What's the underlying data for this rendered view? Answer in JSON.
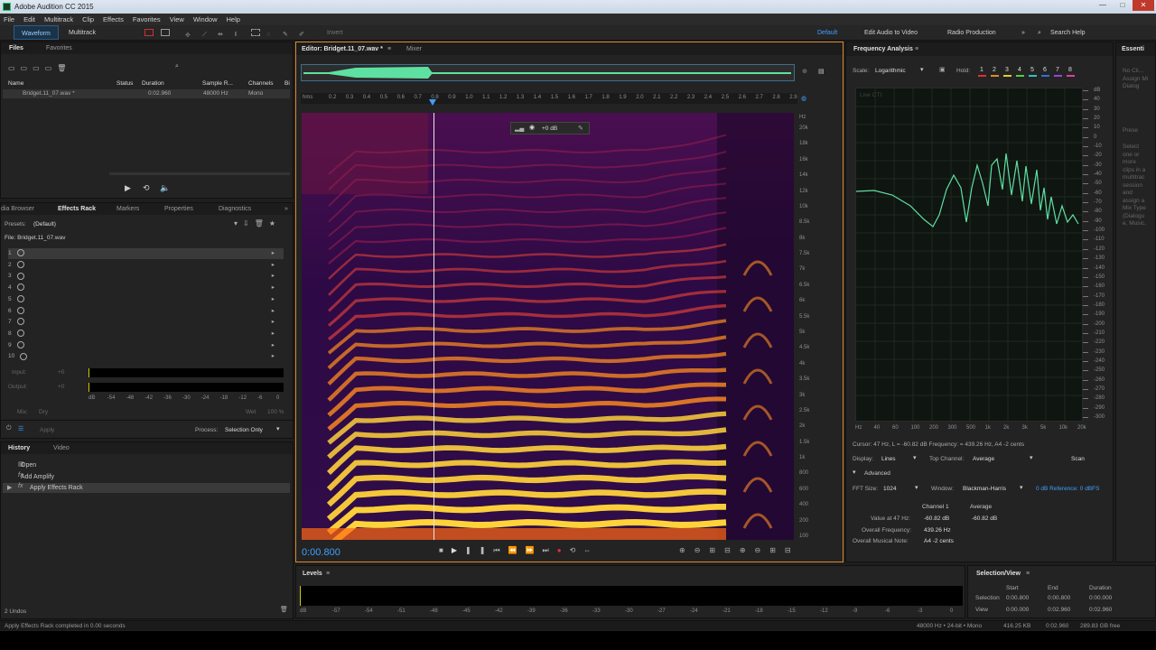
{
  "window": {
    "title": "Adobe Audition CC 2015"
  },
  "menu": [
    "File",
    "Edit",
    "Multitrack",
    "Clip",
    "Effects",
    "Favorites",
    "View",
    "Window",
    "Help"
  ],
  "toolbar": {
    "waveform": "Waveform",
    "multitrack": "Multitrack",
    "invert": "Invert",
    "workspace_default": "Default",
    "edit_video": "Edit Audio to Video",
    "radio": "Radio Production",
    "search": "Search Help"
  },
  "files": {
    "tabs": [
      "Files",
      "Favorites"
    ],
    "columns": [
      "Name",
      "Status",
      "Duration",
      "Sample R...",
      "Channels",
      "Bi"
    ],
    "rows": [
      {
        "name": "Bridget.11_07.wav *",
        "duration": "0:02.960",
        "rate": "48000 Hz",
        "channels": "Mono"
      }
    ]
  },
  "effects": {
    "tabs": [
      "dia Browser",
      "Effects Rack",
      "Markers",
      "Properties",
      "Diagnostics"
    ],
    "presets_label": "Presets:",
    "presets_value": "(Default)",
    "file_label": "File: Bridget.11_07.wav",
    "slots": [
      "1",
      "2",
      "3",
      "4",
      "5",
      "6",
      "7",
      "8",
      "9",
      "10"
    ],
    "input_label": "Input:",
    "input_val": "+0",
    "output_label": "Output:",
    "output_val": "+0",
    "meter_ticks": [
      "dB",
      "-54",
      "-48",
      "-42",
      "-36",
      "-30",
      "-24",
      "-18",
      "-12",
      "-6",
      "0"
    ],
    "mix_label": "Mix:",
    "dry": "Dry",
    "wet": "Wet",
    "wet_pct": "100 %",
    "apply": "Apply",
    "process_label": "Process:",
    "process_value": "Selection Only"
  },
  "history": {
    "tabs": [
      "History",
      "Video"
    ],
    "items": [
      "Open",
      "Add Amplify",
      "Apply Effects Rack"
    ],
    "undos": "2 Undos"
  },
  "editor": {
    "tabs": [
      "Editor: Bridget.11_07.wav *",
      "Mixer"
    ],
    "ruler_unit": "hms",
    "ruler": [
      "0.2",
      "0.3",
      "0.4",
      "0.5",
      "0.6",
      "0.7",
      "0.8",
      "0.9",
      "1.0",
      "1.1",
      "1.2",
      "1.3",
      "1.4",
      "1.5",
      "1.6",
      "1.7",
      "1.8",
      "1.9",
      "2.0",
      "2.1",
      "2.2",
      "2.3",
      "2.4",
      "2.5",
      "2.6",
      "2.7",
      "2.8",
      "2.9"
    ],
    "hz_label": "Hz",
    "hz_ticks": [
      "20k",
      "18k",
      "16k",
      "14k",
      "12k",
      "10k",
      "8.5k",
      "8k",
      "7.5k",
      "7k",
      "6.5k",
      "6k",
      "5.5k",
      "5k",
      "4.5k",
      "4k",
      "3.5k",
      "3k",
      "2.5k",
      "2k",
      "1.5k",
      "1k",
      "800",
      "600",
      "400",
      "200",
      "100"
    ],
    "hud": "+0 dB",
    "time": "0:00.800",
    "playhead_fraction": 0.27
  },
  "freq": {
    "title": "Frequency Analysis",
    "scale_label": "Scale:",
    "scale_value": "Logarithmic",
    "hold_label": "Hold:",
    "holds": [
      "1",
      "2",
      "3",
      "4",
      "5",
      "6",
      "7",
      "8"
    ],
    "hold_colors": [
      "#e03030",
      "#e08a20",
      "#e0d020",
      "#50d040",
      "#30c0c0",
      "#3070e0",
      "#a040e0",
      "#e040a0"
    ],
    "live_cti": "Live CTI",
    "db_ticks": [
      "dB",
      "40",
      "30",
      "20",
      "10",
      "0",
      "-10",
      "-20",
      "-30",
      "-40",
      "-50",
      "-60",
      "-70",
      "-80",
      "-90",
      "-100",
      "-110",
      "-120",
      "-130",
      "-140",
      "-150",
      "-160",
      "-170",
      "-180",
      "-190",
      "-200",
      "-210",
      "-220",
      "-230",
      "-240",
      "-250",
      "-260",
      "-270",
      "-280",
      "-290",
      "-300"
    ],
    "x_ticks": [
      "Hz",
      "40",
      "60",
      "100",
      "200",
      "300",
      "500",
      "1k",
      "2k",
      "3k",
      "5k",
      "10k",
      "20k"
    ],
    "cursor_text": "Cursor: 47 Hz, L = -60.82 dB  Frequency: = 439.26 Hz, A4 -2 cents",
    "display_label": "Display:",
    "display_value": "Lines",
    "topch_label": "Top Channel:",
    "topch_value": "Average",
    "scan": "Scan",
    "advanced": "Advanced",
    "fft_label": "FFT Size:",
    "fft_value": "1024",
    "window_label": "Window:",
    "window_value": "Blackman-Harris",
    "ref_text": "0 dB Reference: 0 dBFS",
    "col1": "Channel 1",
    "col2": "Average",
    "value_label": "Value at 47 Hz:",
    "value1": "-60.82 dB",
    "value2": "-60.82 dB",
    "overall_label": "Overall Frequency:",
    "overall1": "439.26 Hz",
    "note_label": "Overall Musical Note:",
    "note1": "A4 -2 cents"
  },
  "essential": {
    "title": "Essenti",
    "lines": [
      "No Cli...",
      "Assign Mi",
      "Dialog",
      "Prese",
      "Select",
      "one or",
      "more",
      "clips in a",
      "multitrac",
      "session",
      "and",
      "assign a",
      "Mix Type",
      "(Dialogu",
      "e, Music,"
    ]
  },
  "levels": {
    "title": "Levels",
    "ticks": [
      "dB",
      "-57",
      "-54",
      "-51",
      "-48",
      "-45",
      "-42",
      "-39",
      "-36",
      "-33",
      "-30",
      "-27",
      "-24",
      "-21",
      "-18",
      "-15",
      "-12",
      "-9",
      "-6",
      "-3",
      "0"
    ]
  },
  "selection": {
    "title": "Selection/View",
    "cols": [
      "Start",
      "End",
      "Duration"
    ],
    "sel_label": "Selection",
    "sel": [
      "0:00.800",
      "0:00.800",
      "0:00.000"
    ],
    "view_label": "View",
    "view": [
      "0:00.000",
      "0:02.960",
      "0:02.960"
    ]
  },
  "status": {
    "left": "Apply Effects Rack completed in 0.00 seconds",
    "right": [
      "48000 Hz • 24-bit • Mono",
      "416.25 KB",
      "0:02.960",
      "289.83 GB free"
    ]
  }
}
